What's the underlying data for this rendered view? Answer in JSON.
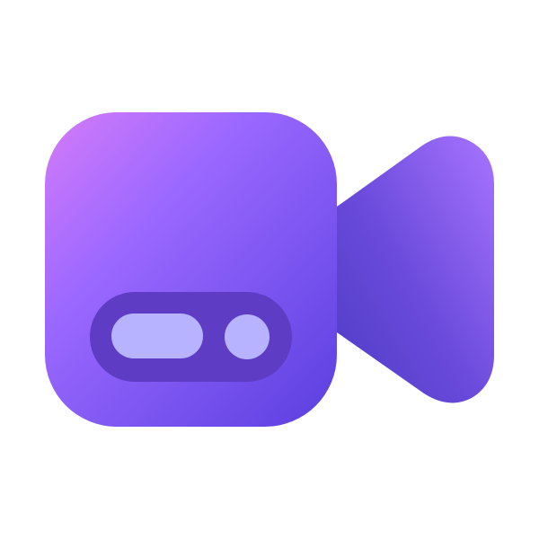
{
  "icon": {
    "name": "video-camera-icon",
    "colors": {
      "body_gradient_start": "#D57BFA",
      "body_gradient_mid": "#9A68FF",
      "body_gradient_end": "#5A3FE0",
      "lens_gradient_start": "#A874FF",
      "lens_gradient_end": "#4E3CC4",
      "control_panel": "#5E3CC4",
      "control_pill": "#B8B3FF",
      "control_dot": "#B8B3FF",
      "background": "#FFFFFF"
    }
  }
}
